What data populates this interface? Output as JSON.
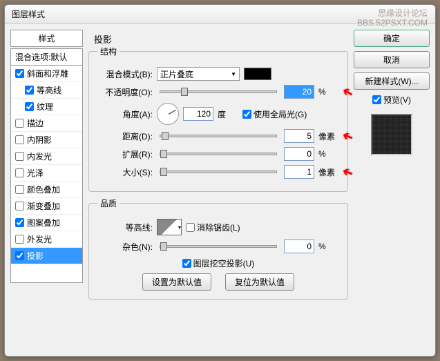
{
  "watermark": {
    "line1": "思缘设计论坛",
    "line2": "BBS.52PSXT.COM"
  },
  "title": "图层样式",
  "styles": {
    "header": "样式",
    "blend": "混合选项:默认",
    "items": [
      {
        "label": "斜面和浮雕",
        "checked": true,
        "indent": 0
      },
      {
        "label": "等高线",
        "checked": true,
        "indent": 1
      },
      {
        "label": "纹理",
        "checked": true,
        "indent": 1
      },
      {
        "label": "描边",
        "checked": false,
        "indent": 0
      },
      {
        "label": "内阴影",
        "checked": false,
        "indent": 0
      },
      {
        "label": "内发光",
        "checked": false,
        "indent": 0
      },
      {
        "label": "光泽",
        "checked": false,
        "indent": 0
      },
      {
        "label": "颜色叠加",
        "checked": false,
        "indent": 0
      },
      {
        "label": "渐变叠加",
        "checked": false,
        "indent": 0
      },
      {
        "label": "图案叠加",
        "checked": true,
        "indent": 0
      },
      {
        "label": "外发光",
        "checked": false,
        "indent": 0
      },
      {
        "label": "投影",
        "checked": true,
        "indent": 0,
        "selected": true
      }
    ]
  },
  "panel": {
    "title": "投影",
    "structure_legend": "结构",
    "blend_mode_label": "混合模式(B):",
    "blend_mode_value": "正片叠底",
    "opacity_label": "不透明度(O):",
    "opacity_value": "20",
    "opacity_unit": "%",
    "angle_label": "角度(A):",
    "angle_value": "120",
    "angle_unit": "度",
    "global_light": "使用全局光(G)",
    "distance_label": "距离(D):",
    "distance_value": "5",
    "distance_unit": "像素",
    "spread_label": "扩展(R):",
    "spread_value": "0",
    "spread_unit": "%",
    "size_label": "大小(S):",
    "size_value": "1",
    "size_unit": "像素",
    "quality_legend": "品质",
    "contour_label": "等高线:",
    "antialias_label": "消除锯齿(L)",
    "noise_label": "杂色(N):",
    "noise_value": "0",
    "noise_unit": "%",
    "knockout_label": "图层挖空投影(U)",
    "btn_default": "设置为默认值",
    "btn_reset": "复位为默认值"
  },
  "right": {
    "ok": "确定",
    "cancel": "取消",
    "new_style": "新建样式(W)...",
    "preview": "预览(V)"
  }
}
